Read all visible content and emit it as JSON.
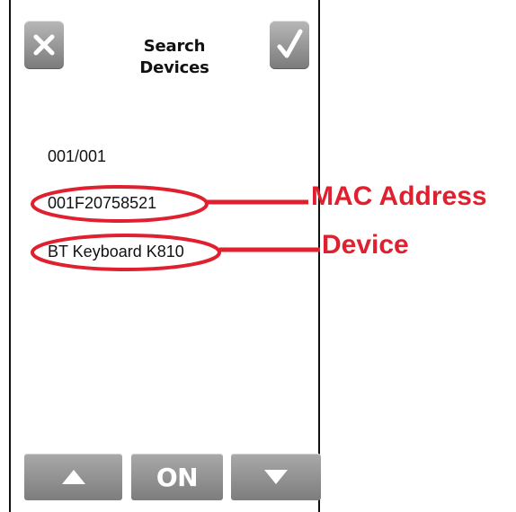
{
  "header": {
    "title_line1": "Search",
    "title_line2": "Devices",
    "cancel_icon": "close-icon",
    "confirm_icon": "checkmark-icon"
  },
  "device_list": {
    "page_counter": "001/001",
    "mac_address": "001F20758521",
    "device_name": "BT Keyboard K810"
  },
  "bottom_bar": {
    "up_icon": "arrow-up-icon",
    "toggle_label": "ON",
    "down_icon": "arrow-down-icon"
  },
  "annotations": {
    "mac_label": "MAC Address",
    "device_label": "Device",
    "color": "#e0202e"
  }
}
